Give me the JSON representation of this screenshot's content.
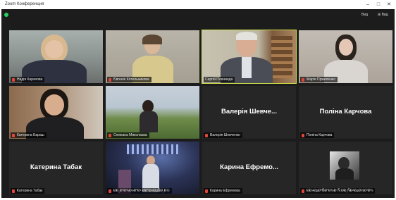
{
  "window": {
    "title": "Zoom Конференция",
    "minimize": "–",
    "maximize": "□",
    "close": "✕"
  },
  "topbar": {
    "view_label_1": "Вид",
    "view_label_2": "Вид"
  },
  "colors": {
    "active_speaker": "#cde04a",
    "muted_mic": "#e0463a",
    "status_dot": "#23d160",
    "tile_bg": "#262626"
  },
  "participants": [
    {
      "name": "Надія Карачова",
      "video": true,
      "muted": true
    },
    {
      "name": "Євгенія Котельникова",
      "video": true,
      "muted": true
    },
    {
      "name": "Сергій Плачинда",
      "video": true,
      "muted": false,
      "active": true
    },
    {
      "name": "Марія Пржиленко",
      "video": true,
      "muted": true
    },
    {
      "name": "Катерина Бараш",
      "video": true,
      "muted": true
    },
    {
      "name": "Снежана Миколаєва",
      "video": true,
      "muted": true
    },
    {
      "name": "Валерія Шевченко",
      "display": "Валерія Шевче...",
      "video": false,
      "muted": true
    },
    {
      "name": "Поліна Карчова",
      "display": "Поліна Карчова",
      "video": false,
      "muted": true
    },
    {
      "name": "Катерина Табак",
      "display": "Катерина Табак",
      "video": false,
      "muted": true
    },
    {
      "name": "ÐÐ¸ÐºÐ¾Ð»Ð°Ð¹ ÐÐ°Ð»ÐµÑÐ¸Ð½",
      "video": true,
      "muted": true
    },
    {
      "name": "Карина Ефремова",
      "display": "Карина  Ефремо...",
      "video": false,
      "muted": true
    },
    {
      "name": "ÐÐ»ÐµÐºÑÐ°Ð½Ð´Ñ ÐÐ¸ÑÐ²ÐµÐ½ÐºÐ¾",
      "video": true,
      "muted": true
    }
  ]
}
